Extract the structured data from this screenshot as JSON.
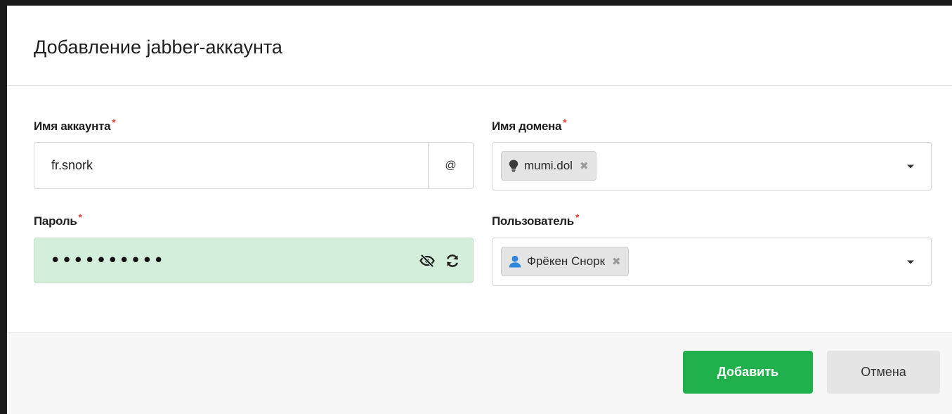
{
  "dialog": {
    "title": "Добавление jabber-аккаунта"
  },
  "form": {
    "account": {
      "label": "Имя аккаунта",
      "required_mark": "*",
      "value": "fr.snork",
      "addon": "@"
    },
    "domain": {
      "label": "Имя домена",
      "required_mark": "*",
      "selected": "mumi.dol",
      "icon": "lightbulb-icon",
      "remove": "✖"
    },
    "password": {
      "label": "Пароль",
      "required_mark": "*",
      "value": "••••••••••",
      "toggle_icon": "eye-slash-icon",
      "generate_icon": "refresh-icon",
      "state_color": "#d3eedb"
    },
    "user": {
      "label": "Пользователь",
      "required_mark": "*",
      "selected": "Фрёкен Снорк",
      "icon": "user-icon",
      "icon_color": "#2e86de",
      "remove": "✖"
    }
  },
  "footer": {
    "submit_label": "Добавить",
    "cancel_label": "Отмена",
    "submit_color": "#20b14c"
  }
}
